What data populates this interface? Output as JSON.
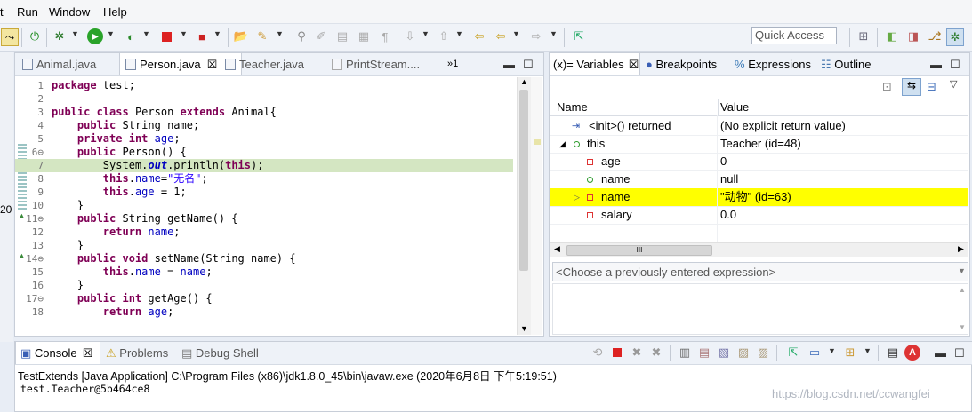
{
  "menu": {
    "t": "t",
    "run": "Run",
    "window": "Window",
    "help": "Help"
  },
  "quick_access": "Quick Access",
  "editor": {
    "tabs": [
      "Animal.java",
      "Person.java",
      "Teacher.java",
      "PrintStream...."
    ],
    "overflow": "»1",
    "lines": [
      {
        "n": "1",
        "t": "package test;"
      },
      {
        "n": "2",
        "t": ""
      },
      {
        "n": "3",
        "t": "public class Person extends Animal{"
      },
      {
        "n": "4",
        "t": "    public String name;"
      },
      {
        "n": "5",
        "t": "    private int age;"
      },
      {
        "n": "6⊖",
        "t": "    public Person() {"
      },
      {
        "n": "7",
        "t": "        System.out.println(this);"
      },
      {
        "n": "8",
        "t": "        this.name=\"无名\";"
      },
      {
        "n": "9",
        "t": "        this.age = 1;"
      },
      {
        "n": "10",
        "t": "    }"
      },
      {
        "n": "11⊖",
        "t": "    public String getName() {"
      },
      {
        "n": "12",
        "t": "        return name;"
      },
      {
        "n": "13",
        "t": "    }"
      },
      {
        "n": "14⊖",
        "t": "    public void setName(String name) {"
      },
      {
        "n": "15",
        "t": "        this.name = name;"
      },
      {
        "n": "16",
        "t": "    }"
      },
      {
        "n": "17⊖",
        "t": "    public int getAge() {"
      },
      {
        "n": "18",
        "t": "        return age;"
      }
    ]
  },
  "variables": {
    "tabs": [
      "(x)= Variables",
      "Breakpoints",
      "Expressions",
      "Outline"
    ],
    "col_name": "Name",
    "col_value": "Value",
    "rows": [
      {
        "name": "<init>() returned",
        "value": "(No explicit return value)"
      },
      {
        "name": "this",
        "value": "Teacher  (id=48)"
      },
      {
        "name": "age",
        "value": "0"
      },
      {
        "name": "name",
        "value": "null"
      },
      {
        "name": "name",
        "value": "\"动物\" (id=63)"
      },
      {
        "name": "salary",
        "value": "0.0"
      }
    ],
    "scroll_mark": "III",
    "expr_placeholder": "<Choose a previously entered expression>"
  },
  "console": {
    "tabs": [
      "Console",
      "Problems",
      "Debug Shell"
    ],
    "launch": "TestExtends [Java Application] C:\\Program Files (x86)\\jdk1.8.0_45\\bin\\javaw.exe (2020年6月8日 下午5:19:51)",
    "output": "test.Teacher@5b464ce8"
  },
  "watermark": "https://blog.csdn.net/ccwangfei",
  "side_mark": "20",
  "colors": {
    "highlight": "#ffff00",
    "current_line": "#d4e6c2",
    "keyword": "#7f0055",
    "field": "#0000c0",
    "string": "#2a00ff"
  }
}
